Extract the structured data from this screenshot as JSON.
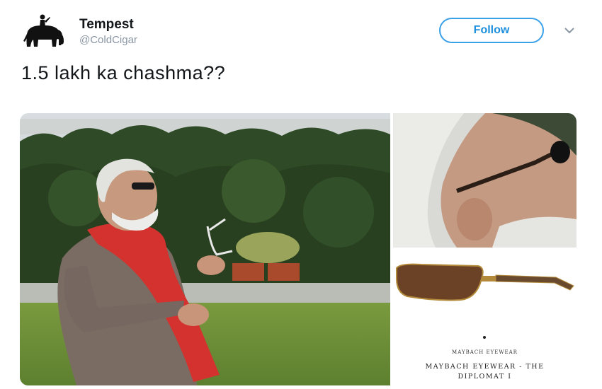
{
  "tweet": {
    "display_name": "Tempest",
    "handle": "@ColdCigar",
    "text": "1.5 lakh ka chashma??",
    "follow_label": "Follow",
    "avatar_icon": "elephant-rider-icon",
    "menu_icon": "chevron-down-icon"
  },
  "media": {
    "product_brand_small": "MAYBACH EYEWEAR",
    "product_title_line1": "MAYBACH EYEWEAR - THE",
    "product_title_line2": "DIPLOMAT I"
  },
  "colors": {
    "accent": "#1da1f2",
    "text": "#14171a",
    "muted": "#8a96a3"
  }
}
